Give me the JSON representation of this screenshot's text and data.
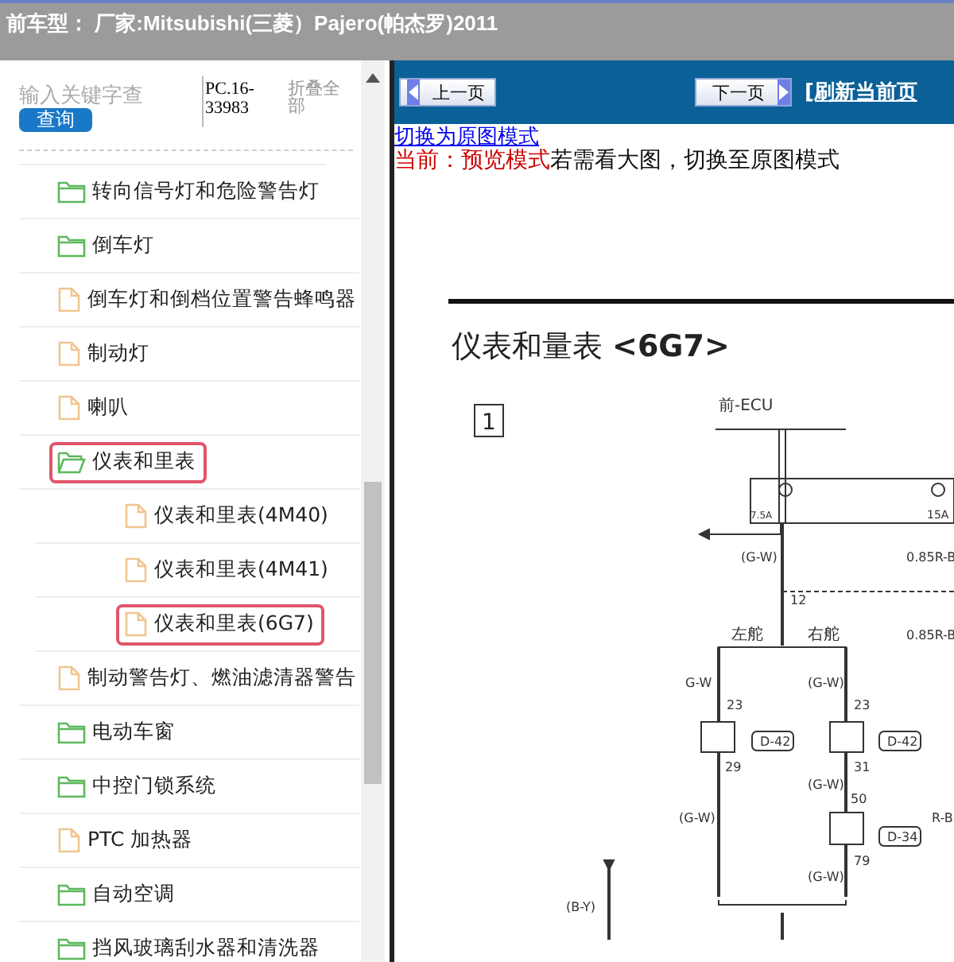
{
  "header": {
    "title": "前车型： 厂家:Mitsubishi(三菱）Pajero(帕杰罗)2011"
  },
  "sidebar": {
    "search": {
      "placeholder": "输入关键字查"
    },
    "search_button": "查询",
    "code": "PC.16-33983",
    "collapse_all": "折叠全部",
    "tree": [
      {
        "kind": "folder",
        "label": "转向信号灯和危险警告灯",
        "expanded": false,
        "selected": false
      },
      {
        "kind": "folder",
        "label": "倒车灯",
        "expanded": false,
        "selected": false
      },
      {
        "kind": "file",
        "label": "倒车灯和倒档位置警告蜂鸣器",
        "selected": false
      },
      {
        "kind": "file",
        "label": "制动灯",
        "selected": false
      },
      {
        "kind": "file",
        "label": "喇叭",
        "selected": false
      },
      {
        "kind": "folder",
        "label": "仪表和里表",
        "expanded": true,
        "selected": true,
        "children": [
          {
            "kind": "file",
            "label": "仪表和里表(4M40)",
            "selected": false
          },
          {
            "kind": "file",
            "label": "仪表和里表(4M41)",
            "selected": false
          },
          {
            "kind": "file",
            "label": "仪表和里表(6G7)",
            "selected": true
          }
        ]
      },
      {
        "kind": "file",
        "label": "制动警告灯、燃油滤清器警告",
        "selected": false
      },
      {
        "kind": "folder",
        "label": "电动车窗",
        "expanded": false,
        "selected": false
      },
      {
        "kind": "folder",
        "label": "中控门锁系统",
        "expanded": false,
        "selected": false
      },
      {
        "kind": "file",
        "label": "PTC 加热器",
        "selected": false
      },
      {
        "kind": "folder",
        "label": "自动空调",
        "expanded": false,
        "selected": false
      },
      {
        "kind": "folder",
        "label": "挡风玻璃刮水器和清洗器",
        "expanded": false,
        "selected": false
      }
    ]
  },
  "toolbar": {
    "prev_button": "上一页",
    "next_button": "下一页",
    "refresh_link": "[刷新当前页"
  },
  "mode": {
    "switch_link": "切换为原图模式",
    "current_label": "当前：预览模式",
    "hint": "若需看大图，切换至原图模式"
  },
  "document": {
    "heading": "仪表和量表 **<6G7>**",
    "box_number": "1",
    "diagram_labels": [
      "前-ECU",
      "7.5A",
      "15A",
      "(G-W)",
      "12",
      "0.85R-B",
      "左舵",
      "右舵",
      "0.85R-B",
      "G-W",
      "(G-W)",
      "23",
      "D-42",
      "29",
      "23",
      "D-42",
      "31",
      "(G-W)",
      "50",
      "D-34",
      "79",
      "(G-W)",
      "R-B",
      "(G-W)",
      "(B-Y)"
    ]
  }
}
